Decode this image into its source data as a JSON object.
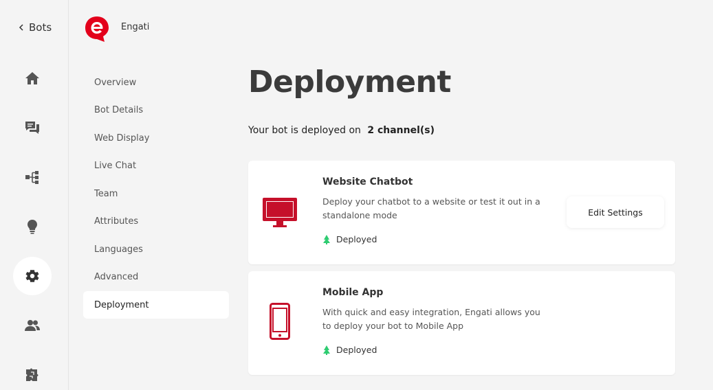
{
  "nav": {
    "back_label": "Bots"
  },
  "bot": {
    "name": "Engati",
    "brand_color": "#e3001b"
  },
  "subnav": {
    "items": [
      {
        "label": "Overview"
      },
      {
        "label": "Bot Details"
      },
      {
        "label": "Web Display"
      },
      {
        "label": "Live Chat"
      },
      {
        "label": "Team"
      },
      {
        "label": "Attributes"
      },
      {
        "label": "Languages"
      },
      {
        "label": "Advanced"
      },
      {
        "label": "Deployment",
        "active": true
      }
    ]
  },
  "main": {
    "title": "Deployment",
    "summary_prefix": "Your bot is deployed on",
    "summary_count": "2 channel(s)",
    "channels": [
      {
        "title": "Website Chatbot",
        "description": "Deploy your chatbot to a website or test it out in a standalone mode",
        "status": "Deployed",
        "icon": "monitor-icon",
        "action_label": "Edit Settings"
      },
      {
        "title": "Mobile App",
        "description": "With quick and easy integration, Engati allows you to deploy your bot to Mobile App",
        "status": "Deployed",
        "icon": "mobile-phone-icon"
      }
    ]
  },
  "colors": {
    "accent_red": "#c5102a",
    "deployed_green": "#2ecc71",
    "rail_icon": "#555555"
  }
}
